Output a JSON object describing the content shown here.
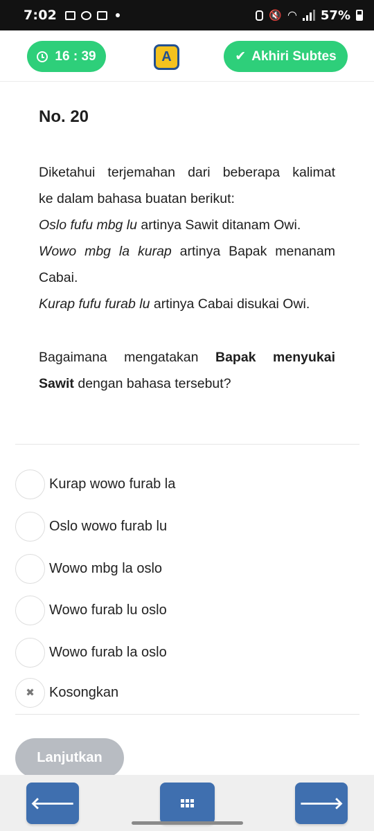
{
  "status_bar": {
    "time": "7:02",
    "battery": "57%"
  },
  "header": {
    "timer": "16 : 39",
    "logo_letter": "A",
    "finish_label": "Akhiri Subtes"
  },
  "question": {
    "number": "No. 20",
    "intro_line1": "Diketahui terjemahan dari beberapa kalimat",
    "intro_line2": "ke dalam bahasa buatan berikut:",
    "ex1_italic": "Oslo fufu mbg lu",
    "ex1_rest": " artinya Sawit ditanam Owi.",
    "ex2_italic": "Wowo mbg la kurap",
    "ex2_rest": " artinya Bapak menanam",
    "ex2_cont": "Cabai.",
    "ex3_italic": "Kurap fufu furab lu",
    "ex3_rest": " artinya Cabai disukai Owi.",
    "ask_start": "Bagaimana mengatakan ",
    "ask_bold_1": "Bapak menyukai",
    "ask_bold_2": "Sawit",
    "ask_end": " dengan bahasa tersebut?"
  },
  "options": [
    {
      "label": "Kurap wowo furab la"
    },
    {
      "label": "Oslo wowo furab lu"
    },
    {
      "label": "Wowo mbg la oslo"
    },
    {
      "label": "Wowo furab lu oslo"
    },
    {
      "label": "Wowo furab la oslo"
    }
  ],
  "clear_option": {
    "label": "Kosongkan",
    "icon": "close-icon"
  },
  "next_label": "Lanjutkan",
  "colors": {
    "accent_green": "#2ecf7a",
    "nav_blue": "#3f6faf",
    "disabled_grey": "#b8bcc2",
    "logo_yellow": "#f4c21e"
  }
}
